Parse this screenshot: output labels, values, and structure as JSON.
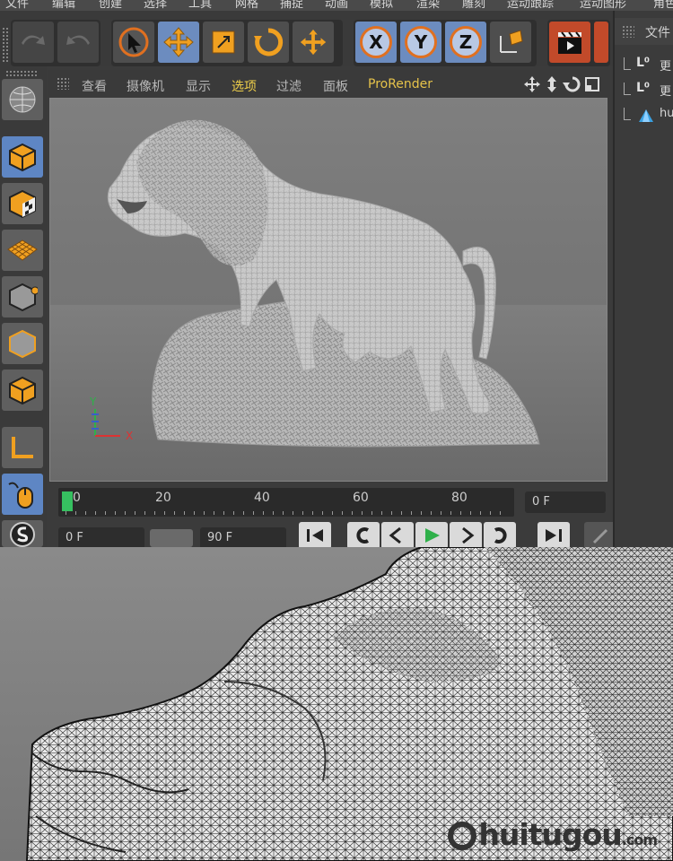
{
  "menu": [
    "文件",
    "编辑",
    "创建",
    "选择",
    "工具",
    "网格",
    "捕捉",
    "动画",
    "模拟",
    "渲染",
    "雕刻",
    "运动跟踪",
    "运动图形",
    "角色"
  ],
  "toolbar": {
    "axis_x": "X",
    "axis_y": "Y",
    "axis_z": "Z"
  },
  "viewport_menu": {
    "items": [
      "查看",
      "摄像机",
      "显示",
      "选项",
      "过滤",
      "面板",
      "ProRender"
    ],
    "selected": "选项"
  },
  "viewport": {
    "axis_y_label": "Y",
    "axis_x_label": "X"
  },
  "timeline": {
    "ticks": [
      "0",
      "20",
      "40",
      "60",
      "80"
    ],
    "current_frame": "0 F"
  },
  "playback": {
    "start_frame": "0 F",
    "end_frame": "90 F"
  },
  "object_manager": {
    "header": "文件",
    "rows": [
      {
        "label": "更",
        "icon": "null-object-icon"
      },
      {
        "label": "更",
        "icon": "null-object-icon"
      },
      {
        "label": "hu",
        "icon": "polygon-object-icon"
      }
    ]
  },
  "watermark": {
    "brand": "huitugou",
    "suffix": ".com"
  },
  "colors": {
    "accent_blue": "#6c8cbf",
    "icon_orange": "#f0a020",
    "selected_menu": "#f0d04a",
    "playhead_green": "#36c060"
  }
}
